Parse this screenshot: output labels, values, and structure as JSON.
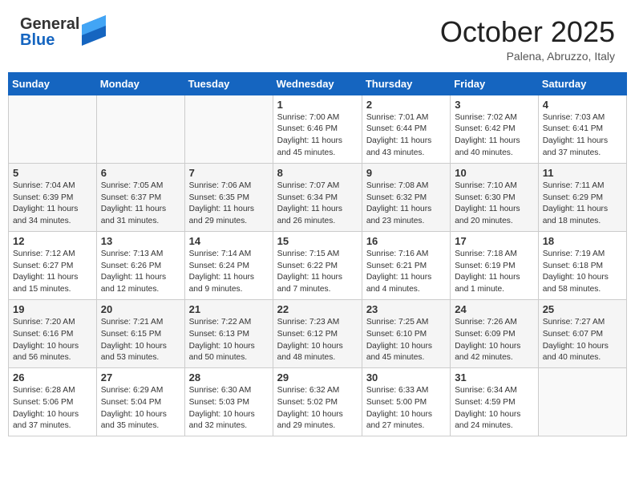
{
  "header": {
    "logo_general": "General",
    "logo_blue": "Blue",
    "title": "October 2025",
    "subtitle": "Palena, Abruzzo, Italy"
  },
  "weekdays": [
    "Sunday",
    "Monday",
    "Tuesday",
    "Wednesday",
    "Thursday",
    "Friday",
    "Saturday"
  ],
  "weeks": [
    [
      {
        "day": "",
        "info": ""
      },
      {
        "day": "",
        "info": ""
      },
      {
        "day": "",
        "info": ""
      },
      {
        "day": "1",
        "info": "Sunrise: 7:00 AM\nSunset: 6:46 PM\nDaylight: 11 hours\nand 45 minutes."
      },
      {
        "day": "2",
        "info": "Sunrise: 7:01 AM\nSunset: 6:44 PM\nDaylight: 11 hours\nand 43 minutes."
      },
      {
        "day": "3",
        "info": "Sunrise: 7:02 AM\nSunset: 6:42 PM\nDaylight: 11 hours\nand 40 minutes."
      },
      {
        "day": "4",
        "info": "Sunrise: 7:03 AM\nSunset: 6:41 PM\nDaylight: 11 hours\nand 37 minutes."
      }
    ],
    [
      {
        "day": "5",
        "info": "Sunrise: 7:04 AM\nSunset: 6:39 PM\nDaylight: 11 hours\nand 34 minutes."
      },
      {
        "day": "6",
        "info": "Sunrise: 7:05 AM\nSunset: 6:37 PM\nDaylight: 11 hours\nand 31 minutes."
      },
      {
        "day": "7",
        "info": "Sunrise: 7:06 AM\nSunset: 6:35 PM\nDaylight: 11 hours\nand 29 minutes."
      },
      {
        "day": "8",
        "info": "Sunrise: 7:07 AM\nSunset: 6:34 PM\nDaylight: 11 hours\nand 26 minutes."
      },
      {
        "day": "9",
        "info": "Sunrise: 7:08 AM\nSunset: 6:32 PM\nDaylight: 11 hours\nand 23 minutes."
      },
      {
        "day": "10",
        "info": "Sunrise: 7:10 AM\nSunset: 6:30 PM\nDaylight: 11 hours\nand 20 minutes."
      },
      {
        "day": "11",
        "info": "Sunrise: 7:11 AM\nSunset: 6:29 PM\nDaylight: 11 hours\nand 18 minutes."
      }
    ],
    [
      {
        "day": "12",
        "info": "Sunrise: 7:12 AM\nSunset: 6:27 PM\nDaylight: 11 hours\nand 15 minutes."
      },
      {
        "day": "13",
        "info": "Sunrise: 7:13 AM\nSunset: 6:26 PM\nDaylight: 11 hours\nand 12 minutes."
      },
      {
        "day": "14",
        "info": "Sunrise: 7:14 AM\nSunset: 6:24 PM\nDaylight: 11 hours\nand 9 minutes."
      },
      {
        "day": "15",
        "info": "Sunrise: 7:15 AM\nSunset: 6:22 PM\nDaylight: 11 hours\nand 7 minutes."
      },
      {
        "day": "16",
        "info": "Sunrise: 7:16 AM\nSunset: 6:21 PM\nDaylight: 11 hours\nand 4 minutes."
      },
      {
        "day": "17",
        "info": "Sunrise: 7:18 AM\nSunset: 6:19 PM\nDaylight: 11 hours\nand 1 minute."
      },
      {
        "day": "18",
        "info": "Sunrise: 7:19 AM\nSunset: 6:18 PM\nDaylight: 10 hours\nand 58 minutes."
      }
    ],
    [
      {
        "day": "19",
        "info": "Sunrise: 7:20 AM\nSunset: 6:16 PM\nDaylight: 10 hours\nand 56 minutes."
      },
      {
        "day": "20",
        "info": "Sunrise: 7:21 AM\nSunset: 6:15 PM\nDaylight: 10 hours\nand 53 minutes."
      },
      {
        "day": "21",
        "info": "Sunrise: 7:22 AM\nSunset: 6:13 PM\nDaylight: 10 hours\nand 50 minutes."
      },
      {
        "day": "22",
        "info": "Sunrise: 7:23 AM\nSunset: 6:12 PM\nDaylight: 10 hours\nand 48 minutes."
      },
      {
        "day": "23",
        "info": "Sunrise: 7:25 AM\nSunset: 6:10 PM\nDaylight: 10 hours\nand 45 minutes."
      },
      {
        "day": "24",
        "info": "Sunrise: 7:26 AM\nSunset: 6:09 PM\nDaylight: 10 hours\nand 42 minutes."
      },
      {
        "day": "25",
        "info": "Sunrise: 7:27 AM\nSunset: 6:07 PM\nDaylight: 10 hours\nand 40 minutes."
      }
    ],
    [
      {
        "day": "26",
        "info": "Sunrise: 6:28 AM\nSunset: 5:06 PM\nDaylight: 10 hours\nand 37 minutes."
      },
      {
        "day": "27",
        "info": "Sunrise: 6:29 AM\nSunset: 5:04 PM\nDaylight: 10 hours\nand 35 minutes."
      },
      {
        "day": "28",
        "info": "Sunrise: 6:30 AM\nSunset: 5:03 PM\nDaylight: 10 hours\nand 32 minutes."
      },
      {
        "day": "29",
        "info": "Sunrise: 6:32 AM\nSunset: 5:02 PM\nDaylight: 10 hours\nand 29 minutes."
      },
      {
        "day": "30",
        "info": "Sunrise: 6:33 AM\nSunset: 5:00 PM\nDaylight: 10 hours\nand 27 minutes."
      },
      {
        "day": "31",
        "info": "Sunrise: 6:34 AM\nSunset: 4:59 PM\nDaylight: 10 hours\nand 24 minutes."
      },
      {
        "day": "",
        "info": ""
      }
    ]
  ]
}
